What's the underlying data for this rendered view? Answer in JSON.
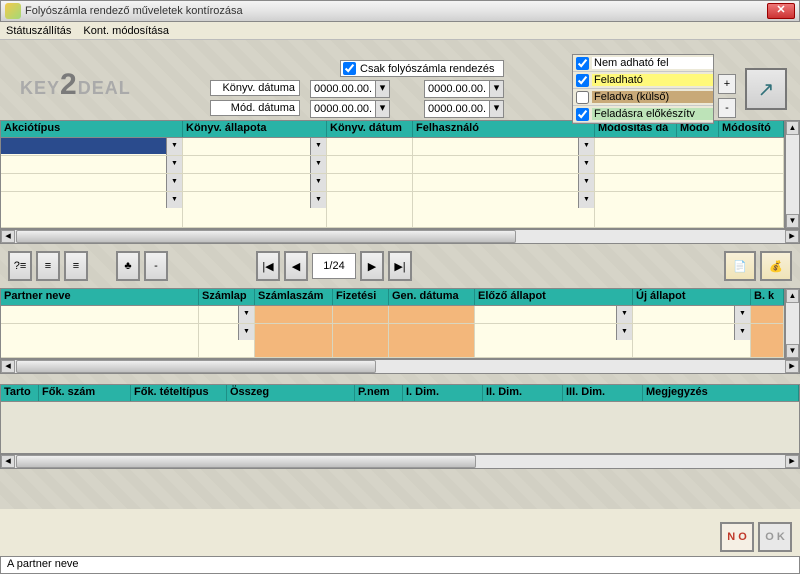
{
  "window": {
    "title": "Folyószámla rendező műveletek kontírozása"
  },
  "menu": {
    "status": "Státuszállítás",
    "modify": "Kont. módosítása"
  },
  "top": {
    "only_current_account": "Csak folyószámla rendezés",
    "book_date_label": "Könyv. dátuma",
    "mod_date_label": "Mód. dátuma",
    "date_placeholder": "0000.00.00."
  },
  "statuses": {
    "s1": "Nem adható fel",
    "s2": "Feladható",
    "s3": "Feladva (külső)",
    "s4": "Feladásra előkészítv"
  },
  "grid1": {
    "h1": "Akciótípus",
    "h2": "Könyv. állapota",
    "h3": "Könyv. dátum",
    "h4": "Felhasználó",
    "h5": "Módosítás dá",
    "h6": "Módo",
    "h7": "Módosító"
  },
  "pager": {
    "value": "1/24"
  },
  "grid2": {
    "h1": "Partner neve",
    "h2": "Számlap",
    "h3": "Számlaszám",
    "h4": "Fizetési",
    "h5": "Gen. dátuma",
    "h6": "Előző állapot",
    "h7": "Új állapot",
    "h8": "B. k"
  },
  "grid3": {
    "h1": "Tarto",
    "h2": "Fők. szám",
    "h3": "Fők. tételtípus",
    "h4": "Összeg",
    "h5": "P.nem",
    "h6": "I. Dim.",
    "h7": "II. Dim.",
    "h8": "III. Dim.",
    "h9": "Megjegyzés"
  },
  "buttons": {
    "no": "N O",
    "ok": "O K"
  },
  "statusbar": "A partner neve"
}
